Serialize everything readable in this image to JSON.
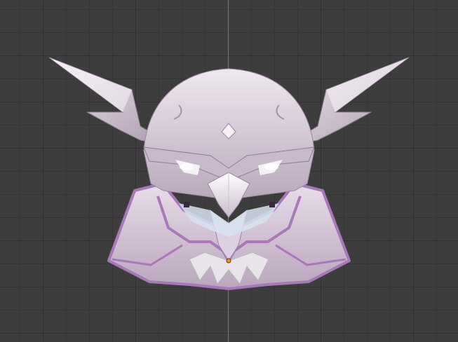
{
  "viewport": {
    "grid": true,
    "axis": "z-axis",
    "axis_color": "#4d7fbf"
  },
  "model": {
    "name": "owl-helmet-model",
    "colors": {
      "body_light": "#ece4ee",
      "body_mid": "#c8b8cb",
      "body_dark": "#9b879e",
      "trim": "#a779b8",
      "origin": "#f19a1d"
    }
  }
}
